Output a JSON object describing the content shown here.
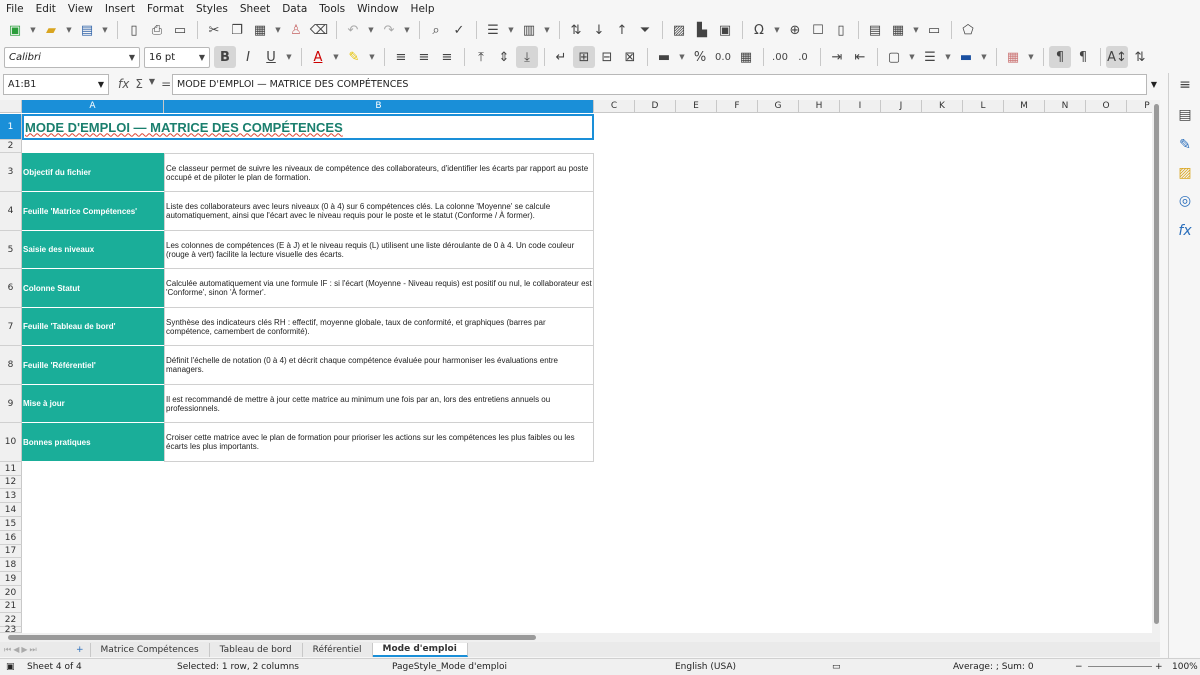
{
  "menubar": [
    "File",
    "Edit",
    "View",
    "Insert",
    "Format",
    "Styles",
    "Sheet",
    "Data",
    "Tools",
    "Window",
    "Help"
  ],
  "font": {
    "name": "Calibri",
    "size": "16 pt"
  },
  "namebox": "A1:B1",
  "formula": "MODE D'EMPLOI — MATRICE DES COMPÉTENCES",
  "columns": [
    "A",
    "B",
    "C",
    "D",
    "E",
    "F",
    "G",
    "H",
    "I",
    "J",
    "K",
    "L",
    "M",
    "N",
    "O",
    "P"
  ],
  "rows": [
    "1",
    "2",
    "3",
    "4",
    "5",
    "6",
    "7",
    "8",
    "9",
    "10",
    "11",
    "12",
    "13",
    "14",
    "15",
    "16",
    "17",
    "18",
    "19",
    "20",
    "21",
    "22",
    "23"
  ],
  "title": "MODE D'EMPLOI — MATRICE DES COMPÉTENCES",
  "entries": [
    {
      "label": "Objectif du fichier",
      "text": "Ce classeur permet de suivre les niveaux de compétence des collaborateurs, d'identifier les écarts par rapport au poste occupé et de piloter le plan de formation."
    },
    {
      "label": "Feuille 'Matrice Compétences'",
      "text": "Liste des collaborateurs avec leurs niveaux (0 à 4) sur 6 compétences clés. La colonne 'Moyenne' se calcule automatiquement, ainsi que l'écart avec le niveau requis pour le poste et le statut (Conforme / À former)."
    },
    {
      "label": "Saisie des niveaux",
      "text": "Les colonnes de compétences (E à J) et le niveau requis (L) utilisent une liste déroulante de 0 à 4. Un code couleur (rouge à vert) facilite la lecture visuelle des écarts."
    },
    {
      "label": "Colonne Statut",
      "text": "Calculée automatiquement via une formule IF : si l'écart (Moyenne - Niveau requis) est positif ou nul, le collaborateur est 'Conforme', sinon 'À former'."
    },
    {
      "label": "Feuille 'Tableau de bord'",
      "text": "Synthèse des indicateurs clés RH : effectif, moyenne globale, taux de conformité, et graphiques (barres par compétence, camembert de conformité)."
    },
    {
      "label": "Feuille 'Référentiel'",
      "text": "Définit l'échelle de notation (0 à 4) et décrit chaque compétence évaluée pour harmoniser les évaluations entre managers."
    },
    {
      "label": "Mise à jour",
      "text": "Il est recommandé de mettre à jour cette matrice au minimum une fois par an, lors des entretiens annuels ou professionnels."
    },
    {
      "label": "Bonnes pratiques",
      "text": "Croiser cette matrice avec le plan de formation pour prioriser les actions sur les compétences les plus faibles ou les écarts les plus importants."
    }
  ],
  "tabs": [
    "Matrice Compétences",
    "Tableau de bord",
    "Référentiel",
    "Mode d'emploi"
  ],
  "status": {
    "sheet": "Sheet 4 of 4",
    "selected": "Selected: 1 row, 2 columns",
    "pagestyle": "PageStyle_Mode d'emploi",
    "language": "English (USA)",
    "summary": "Average: ; Sum: 0",
    "zoom": "100%"
  }
}
